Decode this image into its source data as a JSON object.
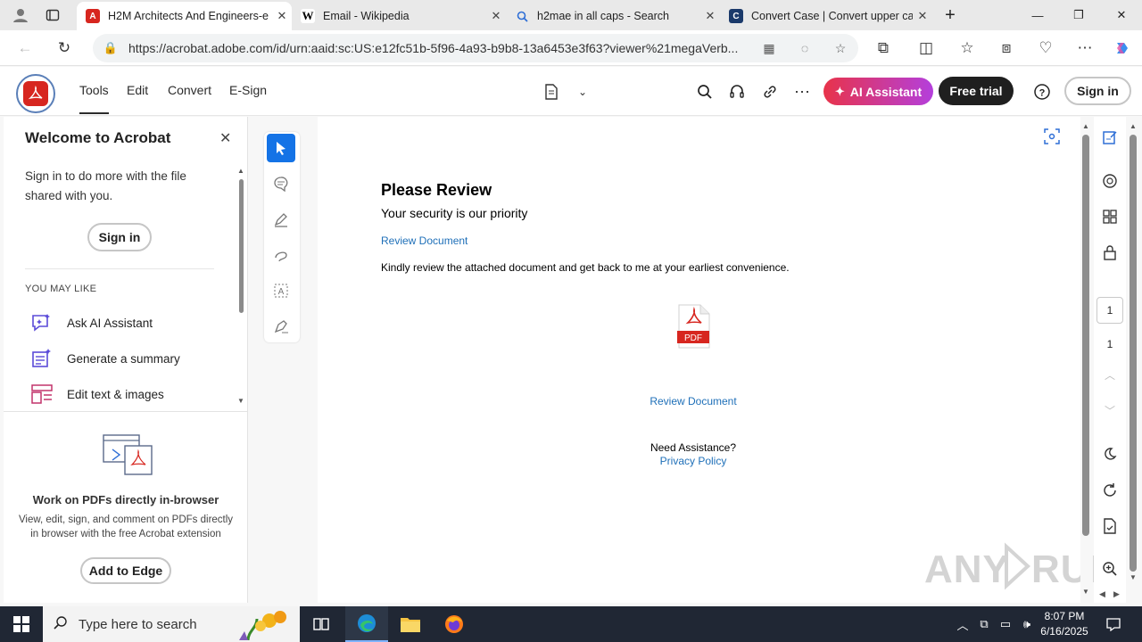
{
  "browser": {
    "tabs": [
      {
        "title": "H2M Architects And Engineers-e",
        "favicon": "acrobat-icon",
        "favicon_color": "#d7261f",
        "active": true
      },
      {
        "title": "Email - Wikipedia",
        "favicon": "wikipedia-icon",
        "favicon_color": "#ffffff",
        "active": false
      },
      {
        "title": "h2mae in all caps - Search",
        "favicon": "search-icon",
        "favicon_color": "#2f6fd6",
        "active": false
      },
      {
        "title": "Convert Case | Convert upper cas",
        "favicon": "convertcase-icon",
        "favicon_color": "#1b3a6b",
        "active": false
      }
    ],
    "url": "https://acrobat.adobe.com/id/urn:aaid:sc:US:e12fc51b-5f96-4a93-b9b8-13a6453e3f63?viewer%21megaVerb...",
    "new_tab_symbol": "+"
  },
  "acrobat": {
    "menu": [
      "Tools",
      "Edit",
      "Convert",
      "E-Sign"
    ],
    "ai_assistant_label": "AI Assistant",
    "free_trial_label": "Free trial",
    "signin_label": "Sign in",
    "accent_color": "#d7261f",
    "selected_tool_color": "#1473e6"
  },
  "welcome_panel": {
    "title": "Welcome to Acrobat",
    "description": "Sign in to do more with the file shared with you.",
    "signin_label": "Sign in",
    "you_may_like": "YOU MAY LIKE",
    "items": [
      {
        "label": "Ask AI Assistant",
        "icon": "ai-assistant-icon"
      },
      {
        "label": "Generate a summary",
        "icon": "summary-icon"
      },
      {
        "label": "Edit text & images",
        "icon": "edit-text-icon"
      }
    ],
    "extension_title": "Work on PDFs directly in-browser",
    "extension_desc": "View, edit, sign, and comment on PDFs directly in browser with the free Acrobat extension",
    "extension_button": "Add to Edge"
  },
  "document": {
    "heading": "Please Review",
    "subheading": "Your security is our priority",
    "link_top": "Review Document",
    "body": "Kindly review the attached document and get back to me at your earliest convenience.",
    "pdf_badge": "PDF",
    "link_bottom": "Review Document",
    "assistance": "Need Assistance?",
    "privacy": "Privacy Policy",
    "link_color": "#1e6fb8"
  },
  "page_nav": {
    "current": "1",
    "total": "1"
  },
  "watermark": "ANY RUN",
  "taskbar": {
    "search_placeholder": "Type here to search",
    "time": "8:07 PM",
    "date": "6/16/2025"
  }
}
